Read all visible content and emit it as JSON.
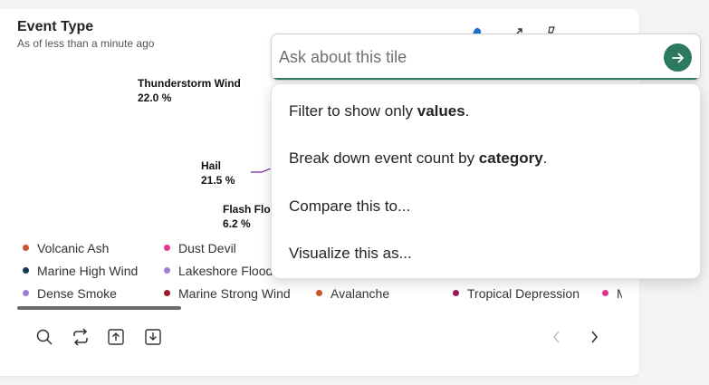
{
  "tile": {
    "title": "Event Type",
    "subtitle": "As of less than a minute ago"
  },
  "chart_data": {
    "type": "pie",
    "slices": [
      {
        "name": "Thunderstorm Wind",
        "value": 22.0,
        "label": "22.0 %"
      },
      {
        "name": "Hail",
        "value": 21.5,
        "label": "21.5 %",
        "color": "#7b1fa2"
      },
      {
        "name": "Flash Flo",
        "value": 6.2,
        "label": "6.2 %"
      }
    ],
    "legend": [
      {
        "name": "Volcanic Ash",
        "color": "#c8552b"
      },
      {
        "name": "Dust Devil",
        "color": "#e0388f"
      },
      {
        "name": "Marine High Wind",
        "color": "#103a56"
      },
      {
        "name": "Lakeshore Flood",
        "color": "#9b7fd1"
      },
      {
        "name": "Dense Smoke",
        "color": "#9b7fd1"
      },
      {
        "name": "Marine Strong Wind",
        "color": "#9e1a2b"
      },
      {
        "name": "Avalanche",
        "color": "#c8552b"
      },
      {
        "name": "Tropical Depression",
        "color": "#9e1a5a"
      },
      {
        "name": "M",
        "color": "#e0388f"
      }
    ]
  },
  "ask": {
    "placeholder": "Ask about this tile"
  },
  "suggestions": [
    {
      "before": "Filter to show only ",
      "bold": "values",
      "after": "."
    },
    {
      "before": "Break down event count by ",
      "bold": "category",
      "after": "."
    },
    {
      "before": "Compare this to...",
      "bold": "",
      "after": ""
    },
    {
      "before": "Visualize this as...",
      "bold": "",
      "after": ""
    }
  ],
  "toolbar": {
    "icons": [
      "search-icon",
      "refresh-icon",
      "upload-icon",
      "download-icon"
    ]
  },
  "pagination": {
    "icons": [
      "chevron-left-icon",
      "chevron-right-icon"
    ]
  },
  "colors": {
    "accent": "#2b7a5f",
    "send_button": "#2b7a5f"
  }
}
